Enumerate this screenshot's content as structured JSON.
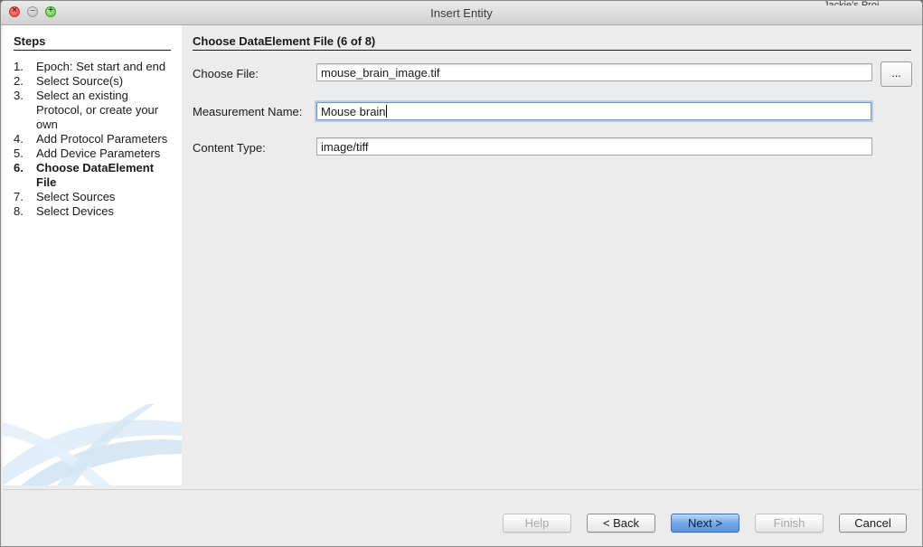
{
  "window": {
    "title": "Insert Entity"
  },
  "background_text": "Jackie's Proj",
  "sidebar": {
    "heading": "Steps",
    "steps": [
      {
        "num": "1.",
        "label": "Epoch: Set start and end"
      },
      {
        "num": "2.",
        "label": "Select Source(s)"
      },
      {
        "num": "3.",
        "label": "Select an existing Protocol, or create your own"
      },
      {
        "num": "4.",
        "label": "Add Protocol Parameters"
      },
      {
        "num": "5.",
        "label": "Add Device Parameters"
      },
      {
        "num": "6.",
        "label": "Choose DataElement File"
      },
      {
        "num": "7.",
        "label": "Select Sources"
      },
      {
        "num": "8.",
        "label": "Select Devices"
      }
    ],
    "current_step": 6
  },
  "panel": {
    "title": "Choose DataElement File (6 of 8)",
    "choose_file": {
      "label": "Choose File:",
      "value": "mouse_brain_image.tif",
      "browse_label": "..."
    },
    "measurement_name": {
      "label": "Measurement Name:",
      "value": "Mouse brain"
    },
    "content_type": {
      "label": "Content Type:",
      "value": "image/tiff"
    }
  },
  "buttons": {
    "help": "Help",
    "back": "< Back",
    "next": "Next >",
    "finish": "Finish",
    "cancel": "Cancel"
  },
  "colors": {
    "default_button": "#6ea6e8",
    "focus_ring": "#6d97c9",
    "close_button": "#e0443e",
    "zoom_button": "#5fbf3a"
  }
}
